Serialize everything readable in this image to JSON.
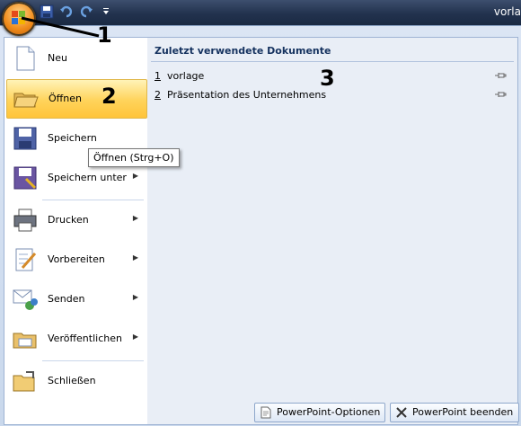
{
  "window_title": "vorla",
  "quick_access": {
    "icons": [
      "save-icon",
      "undo-icon",
      "redo-icon",
      "customize-icon"
    ]
  },
  "menu_items": [
    {
      "label": "Neu",
      "icon": "new-document-icon",
      "has_submenu": false
    },
    {
      "label": "Öffnen",
      "icon": "open-folder-icon",
      "has_submenu": false,
      "selected": true
    },
    {
      "label": "Speichern",
      "icon": "save-icon",
      "has_submenu": false
    },
    {
      "label": "Speichern unter",
      "icon": "save-as-icon",
      "has_submenu": true
    },
    {
      "label": "Drucken",
      "icon": "printer-icon",
      "has_submenu": true
    },
    {
      "label": "Vorbereiten",
      "icon": "prepare-icon",
      "has_submenu": true
    },
    {
      "label": "Senden",
      "icon": "send-icon",
      "has_submenu": true
    },
    {
      "label": "Veröffentlichen",
      "icon": "publish-icon",
      "has_submenu": true
    },
    {
      "label": "Schließen",
      "icon": "close-folder-icon",
      "has_submenu": false
    }
  ],
  "recent": {
    "header": "Zuletzt verwendete Dokumente",
    "items": [
      {
        "num": "1",
        "name": "vorlage"
      },
      {
        "num": "2",
        "name": "Präsentation des Unternehmens"
      }
    ]
  },
  "tooltip": "Öffnen (Strg+O)",
  "footer": {
    "options_label": "PowerPoint-Optionen",
    "exit_label": "PowerPoint beenden"
  },
  "annotations": [
    "1",
    "2",
    "3"
  ],
  "colors": {
    "title_bar": "#22324e",
    "selected_item": "#ffd35a",
    "header_text": "#15325f"
  }
}
